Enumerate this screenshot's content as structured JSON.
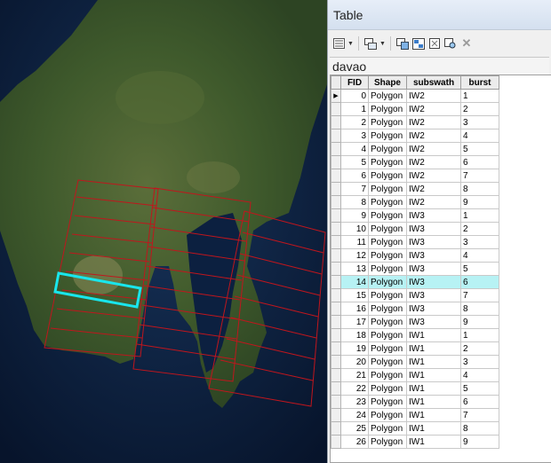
{
  "window": {
    "title": "Table"
  },
  "layer": {
    "name": "davao"
  },
  "toolbar": {
    "icons": [
      "table-options-icon",
      "related-tables-icon",
      "select-by-attributes-icon",
      "switch-selection-icon",
      "clear-selection-icon",
      "zoom-to-selected-icon",
      "delete-selected-icon"
    ]
  },
  "table": {
    "columns": [
      "FID",
      "Shape",
      "subswath",
      "burst"
    ],
    "current_row": 0,
    "highlighted_row": 14,
    "highlight_color": "#b7f2f4",
    "rows": [
      {
        "fid": "0",
        "shape": "Polygon",
        "subswath": "IW2",
        "burst": "1"
      },
      {
        "fid": "1",
        "shape": "Polygon",
        "subswath": "IW2",
        "burst": "2"
      },
      {
        "fid": "2",
        "shape": "Polygon",
        "subswath": "IW2",
        "burst": "3"
      },
      {
        "fid": "3",
        "shape": "Polygon",
        "subswath": "IW2",
        "burst": "4"
      },
      {
        "fid": "4",
        "shape": "Polygon",
        "subswath": "IW2",
        "burst": "5"
      },
      {
        "fid": "5",
        "shape": "Polygon",
        "subswath": "IW2",
        "burst": "6"
      },
      {
        "fid": "6",
        "shape": "Polygon",
        "subswath": "IW2",
        "burst": "7"
      },
      {
        "fid": "7",
        "shape": "Polygon",
        "subswath": "IW2",
        "burst": "8"
      },
      {
        "fid": "8",
        "shape": "Polygon",
        "subswath": "IW2",
        "burst": "9"
      },
      {
        "fid": "9",
        "shape": "Polygon",
        "subswath": "IW3",
        "burst": "1"
      },
      {
        "fid": "10",
        "shape": "Polygon",
        "subswath": "IW3",
        "burst": "2"
      },
      {
        "fid": "11",
        "shape": "Polygon",
        "subswath": "IW3",
        "burst": "3"
      },
      {
        "fid": "12",
        "shape": "Polygon",
        "subswath": "IW3",
        "burst": "4"
      },
      {
        "fid": "13",
        "shape": "Polygon",
        "subswath": "IW3",
        "burst": "5"
      },
      {
        "fid": "14",
        "shape": "Polygon",
        "subswath": "IW3",
        "burst": "6"
      },
      {
        "fid": "15",
        "shape": "Polygon",
        "subswath": "IW3",
        "burst": "7"
      },
      {
        "fid": "16",
        "shape": "Polygon",
        "subswath": "IW3",
        "burst": "8"
      },
      {
        "fid": "17",
        "shape": "Polygon",
        "subswath": "IW3",
        "burst": "9"
      },
      {
        "fid": "18",
        "shape": "Polygon",
        "subswath": "IW1",
        "burst": "1"
      },
      {
        "fid": "19",
        "shape": "Polygon",
        "subswath": "IW1",
        "burst": "2"
      },
      {
        "fid": "20",
        "shape": "Polygon",
        "subswath": "IW1",
        "burst": "3"
      },
      {
        "fid": "21",
        "shape": "Polygon",
        "subswath": "IW1",
        "burst": "4"
      },
      {
        "fid": "22",
        "shape": "Polygon",
        "subswath": "IW1",
        "burst": "5"
      },
      {
        "fid": "23",
        "shape": "Polygon",
        "subswath": "IW1",
        "burst": "6"
      },
      {
        "fid": "24",
        "shape": "Polygon",
        "subswath": "IW1",
        "burst": "7"
      },
      {
        "fid": "25",
        "shape": "Polygon",
        "subswath": "IW1",
        "burst": "8"
      },
      {
        "fid": "26",
        "shape": "Polygon",
        "subswath": "IW1",
        "burst": "9"
      }
    ]
  },
  "map": {
    "footprint_color": "#c0161d",
    "selected_color": "#19e6ec",
    "sea_color": "#0b1a33",
    "land_color": "#3f5a2c"
  }
}
